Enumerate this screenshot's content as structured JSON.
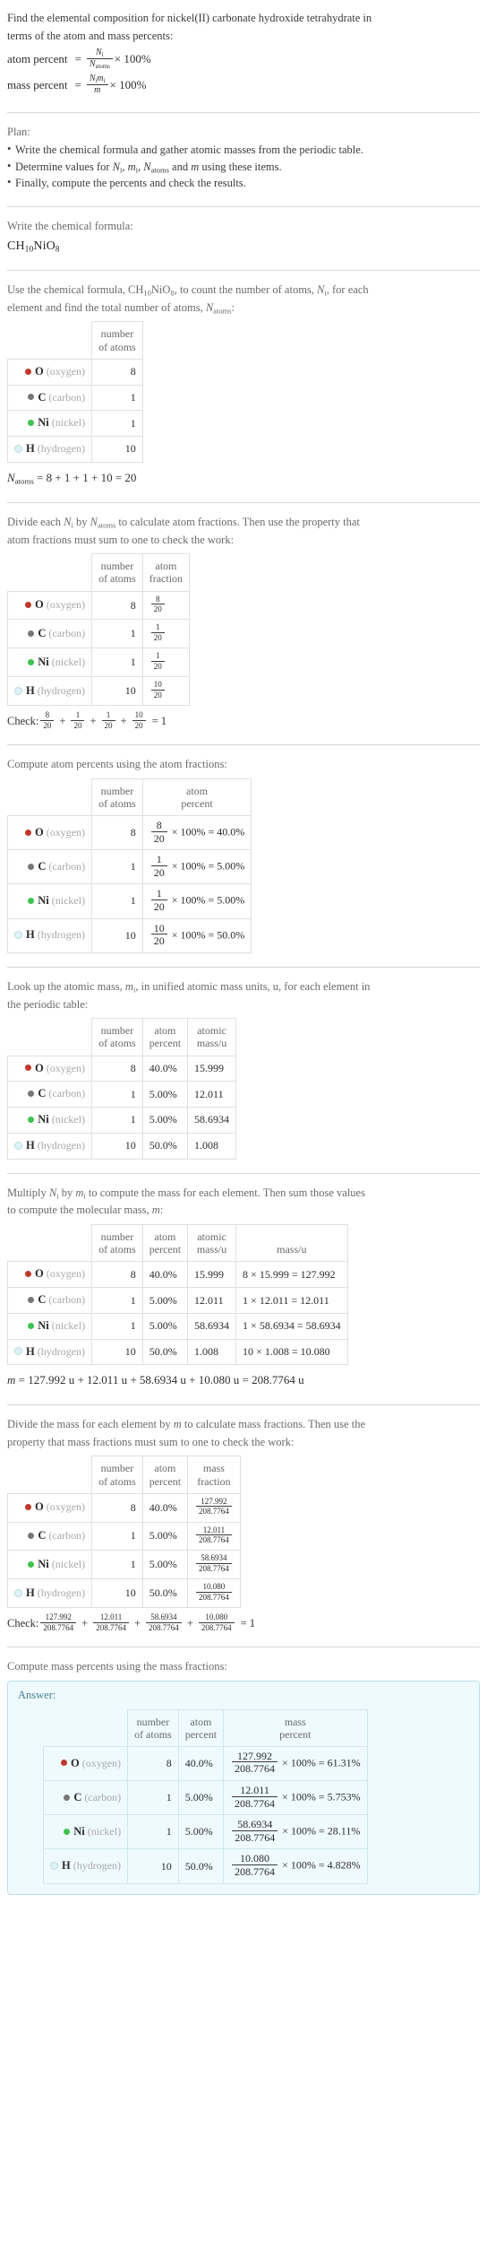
{
  "colors": {
    "oxygen": "#c0392b",
    "carbon": "#777777",
    "nickel": "#3fc34f",
    "hydrogen": "#dff3f7",
    "answer_bg": "#effaff",
    "answer_border": "#b9e0ec"
  },
  "intro": {
    "line1": "Find the elemental composition for nickel(II) carbonate hydroxide tetrahydrate in",
    "line2": "terms of the atom and mass percents:",
    "atom_percent_label": "atom percent",
    "atom_percent_num": "N",
    "atom_percent_num_sub": "i",
    "atom_percent_den": "N",
    "atom_percent_den_sub": "atoms",
    "atom_percent_tail": "× 100%",
    "mass_percent_label": "mass percent",
    "mass_percent_num": "N",
    "mass_percent_num_sub": "i",
    "mass_percent_num2": "m",
    "mass_percent_num2_sub": "i",
    "mass_percent_den": "m",
    "mass_percent_tail": "× 100%",
    "equals": "="
  },
  "plan": {
    "title": "Plan:",
    "items": [
      "Write the chemical formula and gather atomic masses from the periodic table.",
      "Determine values for Nᵢ, mᵢ, Nₐₜₒₘₛ and m using these items.",
      "Finally, compute the percents and check the results."
    ],
    "item2_parts": {
      "pre": "Determine values for ",
      "n": "N",
      "n_sub": "i",
      "mid1": ", ",
      "m": "m",
      "m_sub": "i",
      "mid2": ", ",
      "natoms": "N",
      "natoms_sub": "atoms",
      "mid3": " and ",
      "mm": "m",
      "post": " using these items."
    }
  },
  "formula_section": {
    "prompt": "Write the chemical formula:",
    "formula_parts": [
      {
        "t": "CH",
        "sub": "10"
      },
      {
        "t": "NiO",
        "sub": "8"
      }
    ],
    "formula_plain": "CH10NiO8"
  },
  "count_section": {
    "line1_pre": "Use the chemical formula, ",
    "line1_formula": "CH10NiO8",
    "line1_post": ", to count the number of atoms, ",
    "line1_ni": "N",
    "line1_ni_sub": "i",
    "line1_tail": ", for each",
    "line2_pre": "element and find the total number of atoms, ",
    "line2_natoms": "N",
    "line2_natoms_sub": "atoms",
    "line2_post": ":",
    "headers": [
      "",
      "number of atoms"
    ],
    "header_l1": "number",
    "header_l2": "of atoms",
    "rows": [
      {
        "sym": "O",
        "name": "(oxygen)",
        "color": "oxygen",
        "atoms": "8"
      },
      {
        "sym": "C",
        "name": "(carbon)",
        "color": "carbon",
        "atoms": "1"
      },
      {
        "sym": "Ni",
        "name": "(nickel)",
        "color": "nickel",
        "atoms": "1"
      },
      {
        "sym": "H",
        "name": "(hydrogen)",
        "color": "hydrogen",
        "atoms": "10"
      }
    ],
    "total_label": "N",
    "total_label_sub": "atoms",
    "total_expr": "= 8 + 1 + 1 + 10 = 20"
  },
  "fraction_section": {
    "line1_pre": "Divide each ",
    "line1_ni": "N",
    "line1_ni_sub": "i",
    "line1_mid": " by ",
    "line1_natoms": "N",
    "line1_natoms_sub": "atoms",
    "line1_post": " to calculate atom fractions. Then use the property that",
    "line2": "atom fractions must sum to one to check the work:",
    "h_atoms_l1": "number",
    "h_atoms_l2": "of atoms",
    "h_frac_l1": "atom",
    "h_frac_l2": "fraction",
    "rows": [
      {
        "sym": "O",
        "name": "(oxygen)",
        "color": "oxygen",
        "atoms": "8",
        "num": "8",
        "den": "20"
      },
      {
        "sym": "C",
        "name": "(carbon)",
        "color": "carbon",
        "atoms": "1",
        "num": "1",
        "den": "20"
      },
      {
        "sym": "Ni",
        "name": "(nickel)",
        "color": "nickel",
        "atoms": "1",
        "num": "1",
        "den": "20"
      },
      {
        "sym": "H",
        "name": "(hydrogen)",
        "color": "hydrogen",
        "atoms": "10",
        "num": "10",
        "den": "20"
      }
    ],
    "check_label": "Check:",
    "check_terms": [
      {
        "num": "8",
        "den": "20"
      },
      {
        "num": "1",
        "den": "20"
      },
      {
        "num": "1",
        "den": "20"
      },
      {
        "num": "10",
        "den": "20"
      }
    ],
    "check_result": "= 1",
    "plus": "+"
  },
  "atom_percent_section": {
    "prompt": "Compute atom percents using the atom fractions:",
    "h_atoms_l1": "number",
    "h_atoms_l2": "of atoms",
    "h_pct_l1": "atom",
    "h_pct_l2": "percent",
    "times_100": "× 100% =",
    "rows": [
      {
        "sym": "O",
        "name": "(oxygen)",
        "color": "oxygen",
        "atoms": "8",
        "num": "8",
        "den": "20",
        "result": "40.0%"
      },
      {
        "sym": "C",
        "name": "(carbon)",
        "color": "carbon",
        "atoms": "1",
        "num": "1",
        "den": "20",
        "result": "5.00%"
      },
      {
        "sym": "Ni",
        "name": "(nickel)",
        "color": "nickel",
        "atoms": "1",
        "num": "1",
        "den": "20",
        "result": "5.00%"
      },
      {
        "sym": "H",
        "name": "(hydrogen)",
        "color": "hydrogen",
        "atoms": "10",
        "num": "10",
        "den": "20",
        "result": "50.0%"
      }
    ]
  },
  "atomic_mass_section": {
    "line1_pre": "Look up the atomic mass, ",
    "line1_mi": "m",
    "line1_mi_sub": "i",
    "line1_post": ", in unified atomic mass units, u, for each element in",
    "line2": "the periodic table:",
    "h_atoms_l1": "number",
    "h_atoms_l2": "of atoms",
    "h_pct_l1": "atom",
    "h_pct_l2": "percent",
    "h_mass_l1": "atomic",
    "h_mass_l2": "mass/u",
    "rows": [
      {
        "sym": "O",
        "name": "(oxygen)",
        "color": "oxygen",
        "atoms": "8",
        "pct": "40.0%",
        "mass": "15.999"
      },
      {
        "sym": "C",
        "name": "(carbon)",
        "color": "carbon",
        "atoms": "1",
        "pct": "5.00%",
        "mass": "12.011"
      },
      {
        "sym": "Ni",
        "name": "(nickel)",
        "color": "nickel",
        "atoms": "1",
        "pct": "5.00%",
        "mass": "58.6934"
      },
      {
        "sym": "H",
        "name": "(hydrogen)",
        "color": "hydrogen",
        "atoms": "10",
        "pct": "50.0%",
        "mass": "1.008"
      }
    ]
  },
  "mass_section": {
    "line1_pre": "Multiply ",
    "line1_ni": "N",
    "line1_ni_sub": "i",
    "line1_mid": " by ",
    "line1_mi": "m",
    "line1_mi_sub": "i",
    "line1_post": " to compute the mass for each element. Then sum those values",
    "line2_pre": "to compute the molecular mass, ",
    "line2_m": "m",
    "line2_post": ":",
    "h_atoms_l1": "number",
    "h_atoms_l2": "of atoms",
    "h_pct_l1": "atom",
    "h_pct_l2": "percent",
    "h_amass_l1": "atomic",
    "h_amass_l2": "mass/u",
    "h_mass": "mass/u",
    "rows": [
      {
        "sym": "O",
        "name": "(oxygen)",
        "color": "oxygen",
        "atoms": "8",
        "pct": "40.0%",
        "amass": "15.999",
        "mass": "8 × 15.999 = 127.992"
      },
      {
        "sym": "C",
        "name": "(carbon)",
        "color": "carbon",
        "atoms": "1",
        "pct": "5.00%",
        "amass": "12.011",
        "mass": "1 × 12.011 = 12.011"
      },
      {
        "sym": "Ni",
        "name": "(nickel)",
        "color": "nickel",
        "atoms": "1",
        "pct": "5.00%",
        "amass": "58.6934",
        "mass": "1 × 58.6934 = 58.6934"
      },
      {
        "sym": "H",
        "name": "(hydrogen)",
        "color": "hydrogen",
        "atoms": "10",
        "pct": "50.0%",
        "amass": "1.008",
        "mass": "10 × 1.008 = 10.080"
      }
    ],
    "total_m": "m",
    "total_expr": "= 127.992 u + 12.011 u + 58.6934 u + 10.080 u = 208.7764 u"
  },
  "mass_fraction_section": {
    "line1_pre": "Divide the mass for each element by ",
    "line1_m": "m",
    "line1_post": " to calculate mass fractions. Then use the",
    "line2": "property that mass fractions must sum to one to check the work:",
    "h_atoms_l1": "number",
    "h_atoms_l2": "of atoms",
    "h_pct_l1": "atom",
    "h_pct_l2": "percent",
    "h_frac_l1": "mass",
    "h_frac_l2": "fraction",
    "rows": [
      {
        "sym": "O",
        "name": "(oxygen)",
        "color": "oxygen",
        "atoms": "8",
        "pct": "40.0%",
        "num": "127.992",
        "den": "208.7764"
      },
      {
        "sym": "C",
        "name": "(carbon)",
        "color": "carbon",
        "atoms": "1",
        "pct": "5.00%",
        "num": "12.011",
        "den": "208.7764"
      },
      {
        "sym": "Ni",
        "name": "(nickel)",
        "color": "nickel",
        "atoms": "1",
        "pct": "5.00%",
        "num": "58.6934",
        "den": "208.7764"
      },
      {
        "sym": "H",
        "name": "(hydrogen)",
        "color": "hydrogen",
        "atoms": "10",
        "pct": "50.0%",
        "num": "10.080",
        "den": "208.7764"
      }
    ],
    "check_label": "Check:",
    "check_terms": [
      {
        "num": "127.992",
        "den": "208.7764"
      },
      {
        "num": "12.011",
        "den": "208.7764"
      },
      {
        "num": "58.6934",
        "den": "208.7764"
      },
      {
        "num": "10.080",
        "den": "208.7764"
      }
    ],
    "check_result": "= 1",
    "plus": "+"
  },
  "mass_percent_section": {
    "prompt": "Compute mass percents using the mass fractions:",
    "answer_label": "Answer:",
    "h_atoms_l1": "number",
    "h_atoms_l2": "of atoms",
    "h_pct_l1": "atom",
    "h_pct_l2": "percent",
    "h_mass_l1": "mass",
    "h_mass_l2": "percent",
    "times_100": "× 100% =",
    "rows": [
      {
        "sym": "O",
        "name": "(oxygen)",
        "color": "oxygen",
        "atoms": "8",
        "pct": "40.0%",
        "num": "127.992",
        "den": "208.7764",
        "result": "61.31%"
      },
      {
        "sym": "C",
        "name": "(carbon)",
        "color": "carbon",
        "atoms": "1",
        "pct": "5.00%",
        "num": "12.011",
        "den": "208.7764",
        "result": "5.753%"
      },
      {
        "sym": "Ni",
        "name": "(nickel)",
        "color": "nickel",
        "atoms": "1",
        "pct": "5.00%",
        "num": "58.6934",
        "den": "208.7764",
        "result": "28.11%"
      },
      {
        "sym": "H",
        "name": "(hydrogen)",
        "color": "hydrogen",
        "atoms": "10",
        "pct": "50.0%",
        "num": "10.080",
        "den": "208.7764",
        "result": "4.828%"
      }
    ]
  }
}
